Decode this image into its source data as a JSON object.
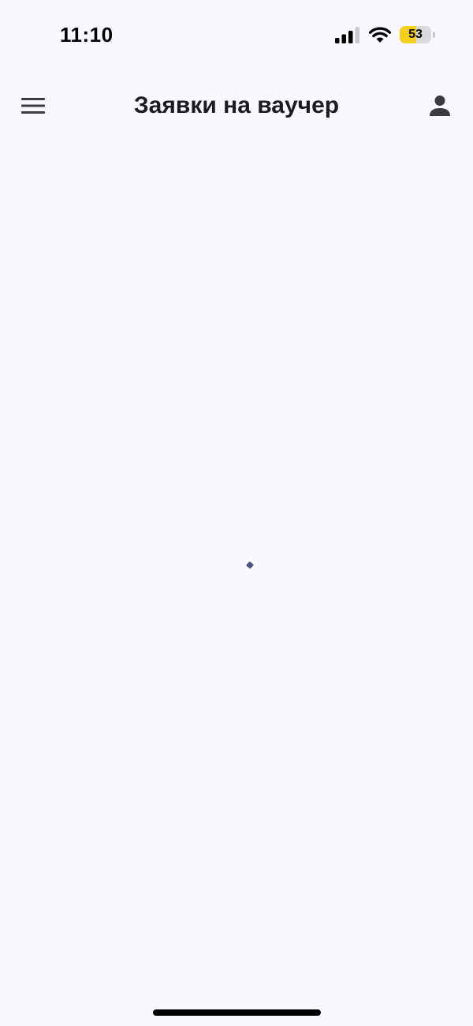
{
  "status_bar": {
    "time": "11:10",
    "signal_icon": "cellular-signal-icon",
    "wifi_icon": "wifi-icon",
    "battery": {
      "level_label": "53",
      "level_fraction": 0.53,
      "fill_color": "#f5cf1d"
    }
  },
  "app_bar": {
    "title": "Заявки на ваучер",
    "menu_icon": "hamburger-menu-icon",
    "profile_icon": "person-icon"
  },
  "content": {
    "loading_indicator_icon": "loading-spinner-icon",
    "accent_color": "#4a5280"
  },
  "colors": {
    "background": "#faf8fe",
    "text": "#1c1b1f",
    "icon": "#3a3a3f"
  }
}
